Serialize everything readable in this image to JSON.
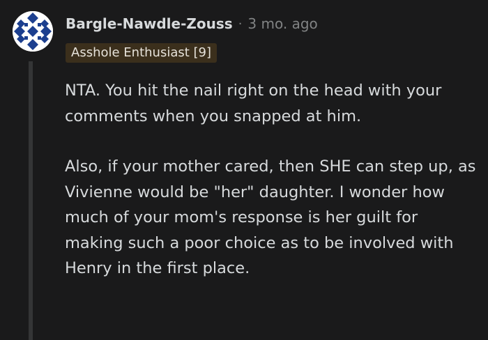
{
  "comment": {
    "author": "Bargle-Nawdle-Zouss",
    "separator": "·",
    "timestamp": "3 mo. ago",
    "flair": "Asshole Enthusiast [9]",
    "avatar_colors": {
      "light": "#ffffff",
      "dark": "#1c3f8f"
    },
    "paragraphs": [
      "NTA. You hit the nail right on the head with your comments when you snapped at him.",
      "Also, if your mother cared, then SHE can step up, as Vivienne would be \"her\" daughter. I wonder how much of your mom's response is her guilt for making such a poor choice as to be involved with Henry in the first place."
    ]
  }
}
